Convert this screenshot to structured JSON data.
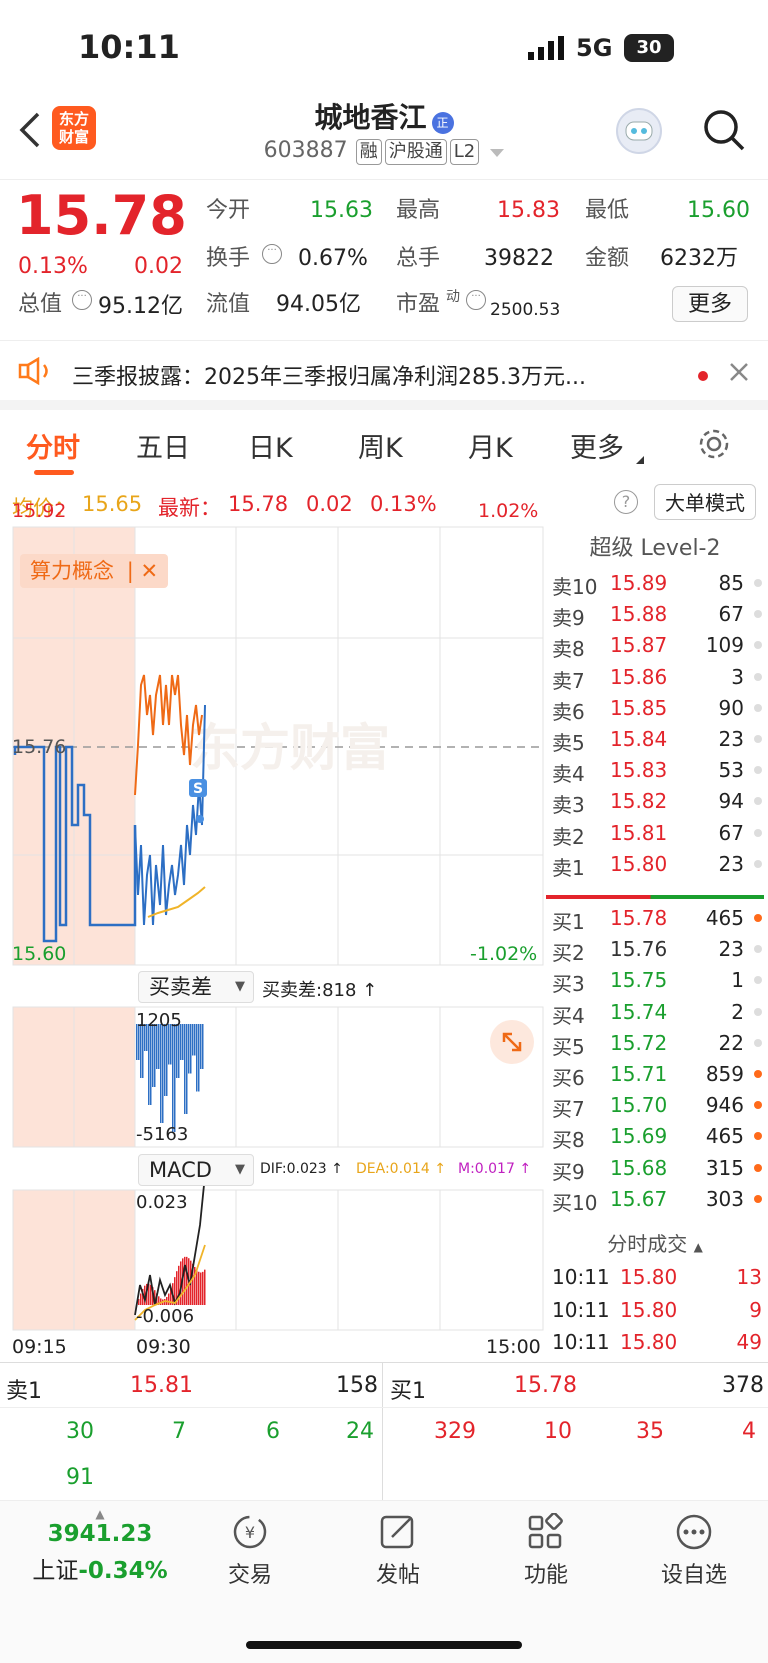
{
  "status": {
    "time": "10:11",
    "network": "5G",
    "battery": "30"
  },
  "header": {
    "name": "城地香江",
    "badge": "正",
    "code": "603887",
    "tags": [
      "融",
      "沪股通",
      "L2"
    ],
    "logo_line1": "东方",
    "logo_line2": "财富"
  },
  "quote": {
    "price": "15.78",
    "pct": "0.13%",
    "chg": "0.02",
    "open_label": "今开",
    "open": "15.63",
    "high_label": "最高",
    "high": "15.83",
    "low_label": "最低",
    "low": "15.60",
    "turnover_label": "换手",
    "turnover": "0.67%",
    "volume_label": "总手",
    "volume": "39822",
    "amount_label": "金额",
    "amount": "6232万",
    "mcap_label": "总值",
    "mcap": "95.12亿",
    "float_label": "流值",
    "float": "94.05亿",
    "pe_label": "市盈",
    "pe_sup": "动",
    "pe": "2500.53",
    "more": "更多"
  },
  "notice": {
    "text": "三季报披露：2025年三季报归属净利润285.3万元..."
  },
  "tabs": [
    "分时",
    "五日",
    "日K",
    "周K",
    "月K",
    "更多"
  ],
  "chart_header": {
    "avg_label": "均价：",
    "avg": "15.65",
    "latest_label": "最新：",
    "latest": "15.78",
    "chg": "0.02",
    "pct": "0.13%",
    "mode": "大单模式"
  },
  "chart_labels": {
    "y_top": "15.92",
    "y_mid": "15.76",
    "y_bottom": "15.60",
    "pct_top": "1.02%",
    "pct_bottom": "-1.02%",
    "concept": "算力概念",
    "watermark": "东方财富",
    "sub1_selector": "买卖差",
    "sub1_value": "买卖差:818 ↑",
    "sub1_top": "1205",
    "sub1_bottom": "-5163",
    "sub2_selector": "MACD",
    "dif": "DIF:0.023 ↑",
    "dea": "DEA:0.014 ↑",
    "m": "M:0.017 ↑",
    "sub2_top": "0.023",
    "sub2_bottom": "-0.006",
    "t_start": "09:15",
    "t_open": "09:30",
    "t_end": "15:00"
  },
  "chart_data": {
    "type": "line",
    "title": "",
    "xlabel": "",
    "ylabel": "",
    "ylim": [
      15.6,
      15.92
    ],
    "ref_price": 15.76,
    "series": [
      {
        "name": "",
        "values": [
          15.76,
          15.76,
          15.74,
          15.6,
          15.62,
          15.64,
          15.65,
          15.7,
          15.78
        ]
      },
      {
        "name": "均价",
        "values": [
          15.62,
          15.63,
          15.64,
          15.645,
          15.65
        ]
      }
    ]
  },
  "orderbook": {
    "title": "超级 Level-2",
    "asks": [
      {
        "label": "卖10",
        "price": "15.89",
        "vol": "85"
      },
      {
        "label": "卖9",
        "price": "15.88",
        "vol": "67"
      },
      {
        "label": "卖8",
        "price": "15.87",
        "vol": "109"
      },
      {
        "label": "卖7",
        "price": "15.86",
        "vol": "3"
      },
      {
        "label": "卖6",
        "price": "15.85",
        "vol": "90"
      },
      {
        "label": "卖5",
        "price": "15.84",
        "vol": "23"
      },
      {
        "label": "卖4",
        "price": "15.83",
        "vol": "53"
      },
      {
        "label": "卖3",
        "price": "15.82",
        "vol": "94"
      },
      {
        "label": "卖2",
        "price": "15.81",
        "vol": "67"
      },
      {
        "label": "卖1",
        "price": "15.80",
        "vol": "23"
      }
    ],
    "bids": [
      {
        "label": "买1",
        "price": "15.78",
        "vol": "465"
      },
      {
        "label": "买2",
        "price": "15.76",
        "vol": "23"
      },
      {
        "label": "买3",
        "price": "15.75",
        "vol": "1"
      },
      {
        "label": "买4",
        "price": "15.74",
        "vol": "2"
      },
      {
        "label": "买5",
        "price": "15.72",
        "vol": "22"
      },
      {
        "label": "买6",
        "price": "15.71",
        "vol": "859"
      },
      {
        "label": "买7",
        "price": "15.70",
        "vol": "946"
      },
      {
        "label": "买8",
        "price": "15.69",
        "vol": "465"
      },
      {
        "label": "买9",
        "price": "15.68",
        "vol": "315"
      },
      {
        "label": "买10",
        "price": "15.67",
        "vol": "303"
      }
    ],
    "trades_title": "分时成交",
    "trades": [
      {
        "time": "10:11",
        "price": "15.80",
        "vol": "13"
      },
      {
        "time": "10:11",
        "price": "15.80",
        "vol": "9"
      },
      {
        "time": "10:11",
        "price": "15.80",
        "vol": "49"
      }
    ]
  },
  "queue": {
    "ask_label": "卖1",
    "ask_price": "15.81",
    "ask_vol": "158",
    "bid_label": "买1",
    "bid_price": "15.78",
    "bid_vol": "378",
    "ask_orders": [
      "30",
      "7",
      "6",
      "24",
      "91"
    ],
    "bid_orders": [
      "329",
      "10",
      "35",
      "4"
    ]
  },
  "bottom": {
    "index_value": "3941.23",
    "index_name": "上证",
    "index_pct": "-0.34%",
    "trade": "交易",
    "post": "发帖",
    "func": "功能",
    "watch": "设自选"
  }
}
